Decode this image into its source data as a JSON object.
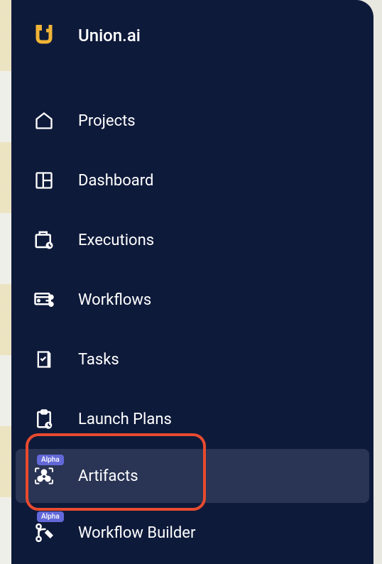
{
  "brand": {
    "label": "Union.ai"
  },
  "nav": {
    "items": [
      {
        "label": "Projects",
        "icon": "home-icon"
      },
      {
        "label": "Dashboard",
        "icon": "dashboard-icon"
      },
      {
        "label": "Executions",
        "icon": "executions-icon"
      },
      {
        "label": "Workflows",
        "icon": "workflows-icon"
      },
      {
        "label": "Tasks",
        "icon": "tasks-icon"
      },
      {
        "label": "Launch Plans",
        "icon": "launch-plans-icon"
      },
      {
        "label": "Artifacts",
        "icon": "artifacts-icon",
        "badge": "Alpha",
        "selected": true
      },
      {
        "label": "Workflow Builder",
        "icon": "workflow-builder-icon",
        "badge": "Alpha"
      }
    ]
  },
  "highlight": {
    "target": "artifacts"
  }
}
